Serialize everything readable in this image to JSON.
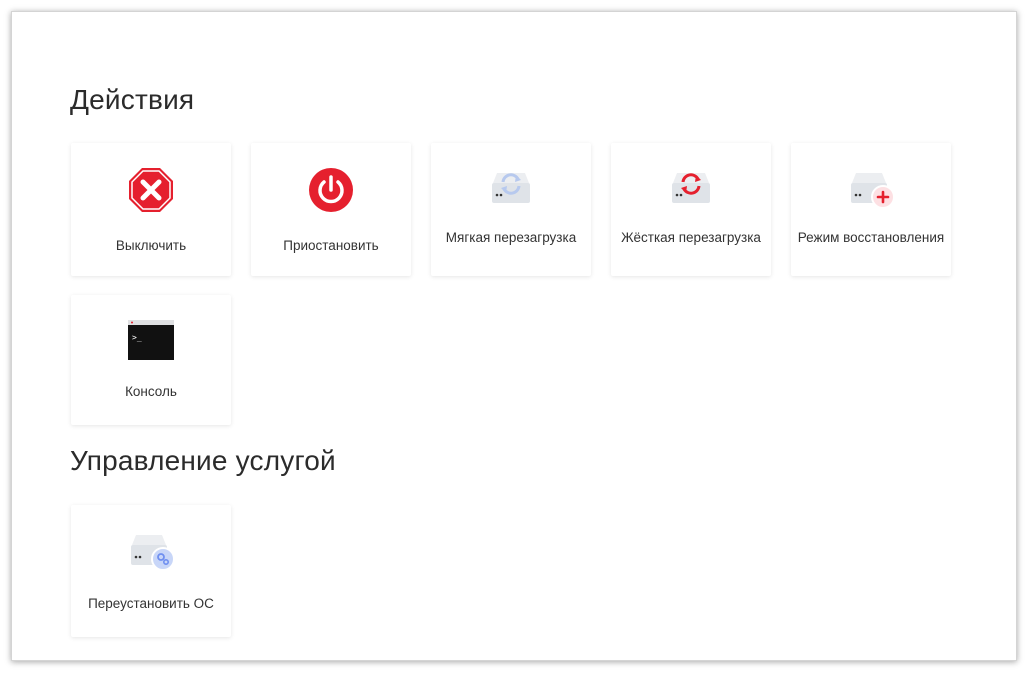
{
  "sections": [
    {
      "title": "Действия",
      "cards": [
        {
          "label": "Выключить",
          "icon": "stop-sign-icon"
        },
        {
          "label": "Приостановить",
          "icon": "power-icon"
        },
        {
          "label": "Мягкая перезагрузка",
          "icon": "drive-soft-reboot-icon"
        },
        {
          "label": "Жёсткая перезагрузка",
          "icon": "drive-hard-reboot-icon"
        },
        {
          "label": "Режим восстановления",
          "icon": "drive-rescue-icon"
        },
        {
          "label": "Консоль",
          "icon": "terminal-icon"
        }
      ]
    },
    {
      "title": "Управление услугой",
      "cards": [
        {
          "label": "Переустановить ОС",
          "icon": "drive-reinstall-icon"
        }
      ]
    }
  ],
  "colors": {
    "danger": "#e5202e",
    "drive": "#dfe3e8",
    "soft_reboot": "#b7c9ee",
    "reinstall": "#6f8ff0",
    "console": "#111111"
  }
}
